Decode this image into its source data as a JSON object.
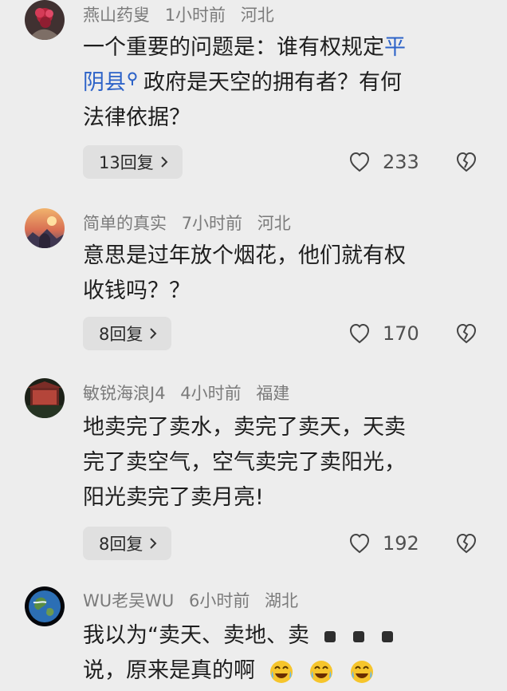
{
  "comments": [
    {
      "username": "燕山药叟",
      "time": "1小时前",
      "location": "河北",
      "avatar_icon": "red-flowers-avatar",
      "text_lines": [
        "一个重要的问题是：谁有权规定",
        "阴县",
        "政府是天空的拥有者？有何",
        "法律依据？"
      ],
      "link_text": [
        "平",
        "阴县"
      ],
      "replies": "13回复",
      "likes": "233",
      "dislike_icon": "broken-heart-icon"
    },
    {
      "username": "简单的真实",
      "time": "7小时前",
      "location": "河北",
      "avatar_icon": "sunset-photo-avatar",
      "text_lines": [
        "意思是过年放个烟花，他们就有权",
        "收钱吗？？"
      ],
      "replies": "8回复",
      "likes": "170",
      "dislike_icon": "broken-heart-icon"
    },
    {
      "username": "敏锐海浪J4",
      "time": "4小时前",
      "location": "福建",
      "avatar_icon": "red-building-avatar",
      "text_lines": [
        "地卖完了卖水，卖完了卖天，天卖",
        "完了卖空气，空气卖完了卖阳光，",
        "阳光卖完了卖月亮!"
      ],
      "replies": "8回复",
      "likes": "192",
      "dislike_icon": "broken-heart-icon"
    },
    {
      "username": "WU老吴WU",
      "time": "6小时前",
      "location": "湖北",
      "avatar_icon": "earth-globe-avatar",
      "text_lines": [
        "我以为“卖天、卖地、卖",
        "说，原来是真的啊"
      ],
      "emoji_icons": [
        "laugh-cry-emoji",
        "laugh-cry-emoji",
        "laugh-cry-emoji"
      ]
    }
  ]
}
